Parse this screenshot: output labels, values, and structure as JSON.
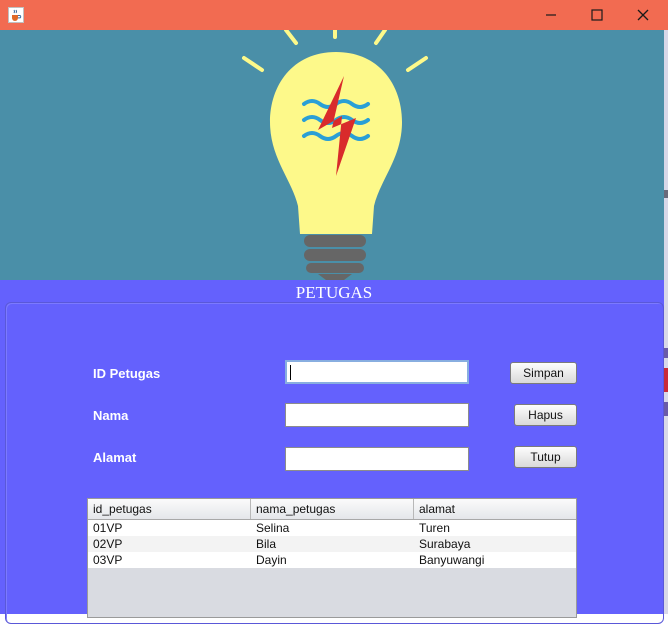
{
  "window": {
    "app_icon": "java-cup-icon",
    "controls": {
      "minimize": "minimize-icon",
      "maximize": "maximize-icon",
      "close": "close-icon"
    }
  },
  "banner": {
    "logo": "lightbulb-pln-logo"
  },
  "panel": {
    "title": "PETUGAS"
  },
  "form": {
    "id_label": "ID Petugas",
    "id_value": "",
    "nama_label": "Nama",
    "nama_value": "",
    "alamat_label": "Alamat",
    "alamat_value": ""
  },
  "buttons": {
    "simpan": "Simpan",
    "hapus": "Hapus",
    "tutup": "Tutup"
  },
  "table": {
    "columns": [
      "id_petugas",
      "nama_petugas",
      "alamat"
    ],
    "rows": [
      [
        "01VP",
        "Selina",
        "Turen"
      ],
      [
        "02VP",
        "Bila",
        "Surabaya"
      ],
      [
        "03VP",
        "Dayin",
        "Banyuwangi"
      ]
    ]
  },
  "colors": {
    "titlebar": "#f26b51",
    "banner": "#4a8fa8",
    "panel": "#6461fd",
    "bulb": "#fdf98a",
    "bolt": "#d92b2b",
    "wave": "#2a9fd6"
  }
}
